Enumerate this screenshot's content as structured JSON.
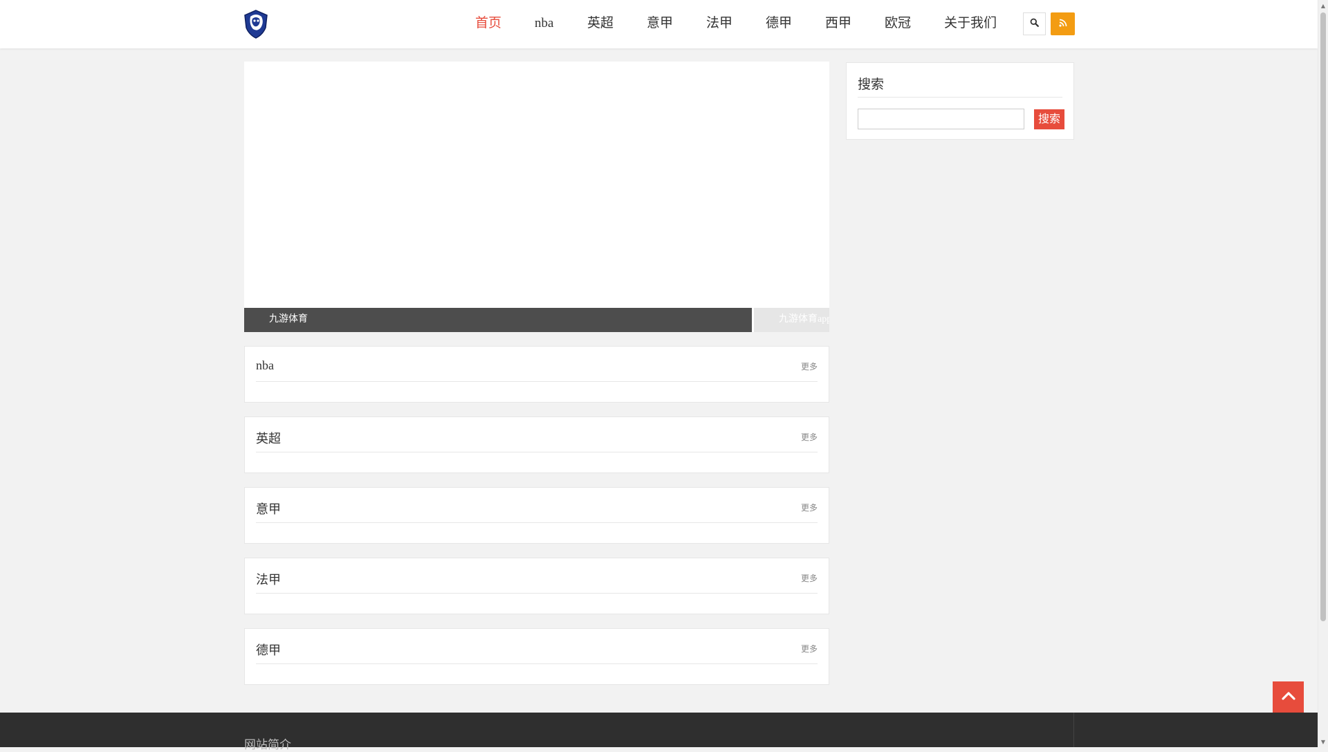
{
  "header": {
    "nav": [
      {
        "label": "首页",
        "active": true
      },
      {
        "label": "nba",
        "active": false
      },
      {
        "label": "英超",
        "active": false
      },
      {
        "label": "意甲",
        "active": false
      },
      {
        "label": "法甲",
        "active": false
      },
      {
        "label": "德甲",
        "active": false
      },
      {
        "label": "西甲",
        "active": false
      },
      {
        "label": "欧冠",
        "active": false
      },
      {
        "label": "关于我们",
        "active": false
      }
    ],
    "search_icon": "search-icon",
    "rss_icon": "rss-icon"
  },
  "slider": {
    "tabs": [
      {
        "label": "九游体育"
      },
      {
        "label": "九游体育app"
      }
    ]
  },
  "sections": [
    {
      "title": "nba",
      "more": "更多"
    },
    {
      "title": "英超",
      "more": "更多"
    },
    {
      "title": "意甲",
      "more": "更多"
    },
    {
      "title": "法甲",
      "more": "更多"
    },
    {
      "title": "德甲",
      "more": "更多"
    }
  ],
  "sidebar": {
    "search_widget": {
      "title": "搜索",
      "input_value": "",
      "button_label": "搜索"
    }
  },
  "footer": {
    "title": "网站简介"
  },
  "colors": {
    "accent": "#e74c3c",
    "rss": "#f39c12",
    "slider_tab_active": "#4d4d4d",
    "footer_bg": "#2f2f2f"
  }
}
